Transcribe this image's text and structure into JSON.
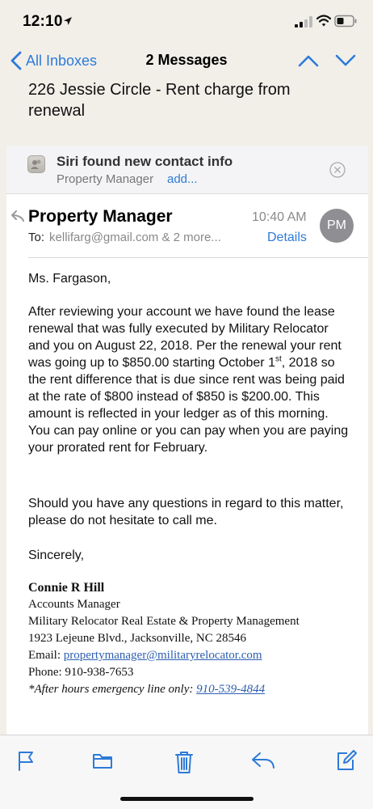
{
  "status_bar": {
    "time": "12:10"
  },
  "nav": {
    "back_label": "All Inboxes",
    "title": "2 Messages"
  },
  "subject": "226 Jessie Circle - Rent charge from renewal",
  "siri": {
    "title": "Siri found new contact info",
    "contact": "Property Manager",
    "add_label": "add..."
  },
  "email": {
    "sender": "Property Manager",
    "time": "10:40 AM",
    "to_label": "To:",
    "to_value": "kellifarg@gmail.com & 2 more...",
    "details_label": "Details",
    "avatar_initials": "PM",
    "greeting": "Ms. Fargason,",
    "para1_a": "After reviewing your account we have found the lease renewal that was fully executed by Military Relocator and you on August 22, 2018. Per the renewal your rent was going up to $850.00 starting October 1",
    "para1_sup": "st",
    "para1_b": ", 2018 so the rent difference that is due since rent was being paid at the rate of $800 instead of $850 is $200.00. This amount is reflected in your ledger as of this morning. You can pay online or you can pay when you are paying your prorated rent for February.",
    "para2": "Should you have any questions in regard to this matter, please do not hesitate to call me.",
    "closing": "Sincerely,"
  },
  "signature": {
    "name": "Connie R Hill",
    "title": "Accounts Manager",
    "company": "Military Relocator Real Estate & Property Management",
    "address": "1923 Lejeune Blvd., Jacksonville, NC 28546",
    "email_label": "Email: ",
    "email": "propertymanager@militaryrelocator.com",
    "phone": "Phone: 910-938-7653",
    "emergency_label": "*After hours emergency line only: ",
    "emergency_phone": "910-539-4844"
  },
  "toolbar": {
    "icons": [
      "flag-icon",
      "folder-icon",
      "trash-icon",
      "reply-icon",
      "compose-icon"
    ]
  },
  "colors": {
    "accent": "#2d7bd8",
    "background": "#f2efe9",
    "avatar": "#8e8e93"
  }
}
